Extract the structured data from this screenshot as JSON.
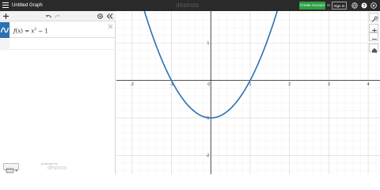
{
  "app": {
    "title": "Untitled Graph",
    "logo": "desmos"
  },
  "header": {
    "create_account": "Create Account",
    "or": "or",
    "sign_in": "Sign In"
  },
  "expressions": [
    {
      "func": "f",
      "var": "x",
      "body": "x",
      "exp": "2",
      "tail": " − 1"
    }
  ],
  "footer": {
    "powered_by": "powered by",
    "logo": "desmos"
  },
  "graph": {
    "x_ticks": [
      "-2",
      "-1",
      "0",
      "1",
      "2",
      "3",
      "4"
    ],
    "y_ticks": [
      "1",
      "-1",
      "-2"
    ]
  },
  "chart_data": {
    "type": "line",
    "title": "",
    "xlabel": "",
    "ylabel": "",
    "xlim": [
      -2.4,
      4.3
    ],
    "ylim": [
      -2.5,
      1.85
    ],
    "series": [
      {
        "name": "f(x) = x^2 - 1",
        "color": "#2d70b3",
        "function": "x^2 - 1",
        "points": [
          [
            -1.7,
            1.89
          ],
          [
            -1.5,
            1.25
          ],
          [
            -1,
            0
          ],
          [
            -0.5,
            -0.75
          ],
          [
            0,
            -1
          ],
          [
            0.5,
            -0.75
          ],
          [
            1,
            0
          ],
          [
            1.5,
            1.25
          ],
          [
            1.7,
            1.89
          ]
        ]
      }
    ],
    "grid": true,
    "colors": {
      "curve": "#2d70b3",
      "accent": "#2f9e44",
      "header": "#2a2a2a"
    }
  }
}
